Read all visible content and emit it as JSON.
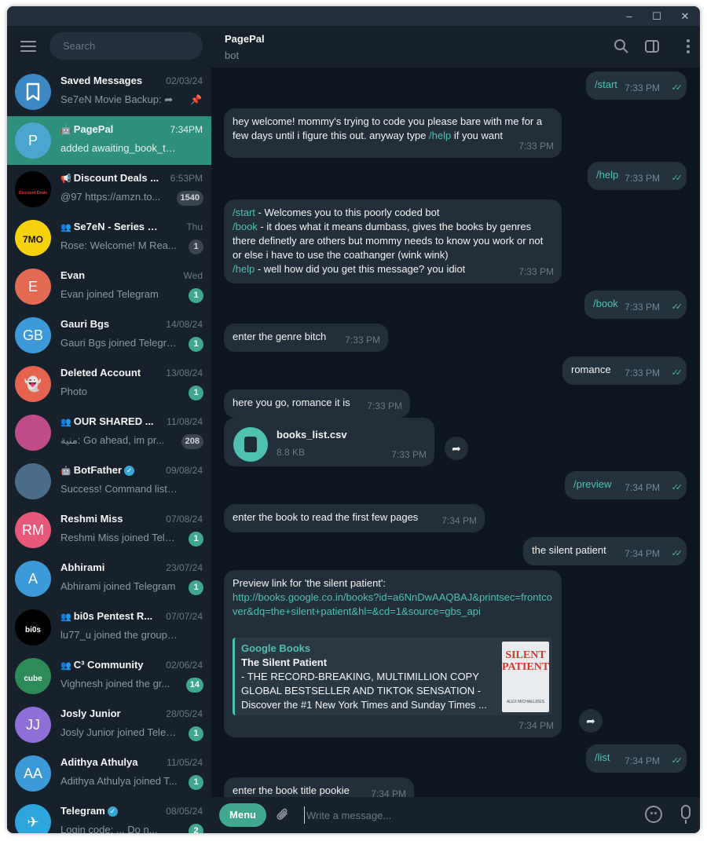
{
  "window": {
    "controls": [
      "–",
      "☐",
      "✕"
    ]
  },
  "sidebar": {
    "search_placeholder": "Search",
    "chats": [
      {
        "name": "Saved Messages",
        "date": "02/03/24",
        "preview": "Se7eN Movie Backup: ➦",
        "avatar_text": "",
        "avatar_color": "#3b88c4",
        "pinned": true
      },
      {
        "name": "PagePal",
        "date": "7:34PM",
        "preview": "added awaiting_book_two t...",
        "avatar_text": "P",
        "avatar_color": "#4aa6cf",
        "bot": true,
        "active": true
      },
      {
        "name": "Discount Deals ...",
        "date": "6:53PM",
        "preview": "@97 https://amzn.to...",
        "avatar_text": "Discount Deals Bay",
        "avatar_color": "#000000",
        "badge": "1540",
        "badge_muted": true,
        "channel": true
      },
      {
        "name": "Se7eN - Series Gro...",
        "date": "Thu",
        "preview": "Rose: Welcome! M  Rea...",
        "avatar_text": "7MO",
        "avatar_color": "#f5d20b",
        "badge": "1",
        "badge_muted": true,
        "group": true
      },
      {
        "name": "Evan",
        "date": "Wed",
        "preview": "Evan joined Telegram",
        "avatar_text": "E",
        "avatar_color": "#e36a53",
        "badge": "1"
      },
      {
        "name": "Gauri Bgs",
        "date": "14/08/24",
        "preview": "Gauri Bgs joined Telegra...",
        "avatar_text": "GB",
        "avatar_color": "#3d9ad8",
        "badge": "1"
      },
      {
        "name": "Deleted Account",
        "date": "13/08/24",
        "preview": "Photo",
        "avatar_text": "👻",
        "avatar_color": "#e6634f",
        "badge": "1"
      },
      {
        "name": "OUR SHARED ...",
        "date": "11/08/24",
        "preview": "منية: Go ahead, im pr...",
        "avatar_text": "",
        "avatar_color": "#c04b8a",
        "badge": "208",
        "badge_muted": true,
        "group": true
      },
      {
        "name": "BotFather",
        "date": "09/08/24",
        "preview": "Success! Command list upd...",
        "avatar_text": "",
        "avatar_color": "#4a6d8c",
        "bot": true,
        "verified": true
      },
      {
        "name": "Reshmi Miss",
        "date": "07/08/24",
        "preview": "Reshmi Miss joined Tele...",
        "avatar_text": "RM",
        "avatar_color": "#e8587a",
        "badge": "1"
      },
      {
        "name": "Abhirami",
        "date": "23/07/24",
        "preview": "Abhirami joined Telegram",
        "avatar_text": "A",
        "avatar_color": "#3d9ad8",
        "badge": "1"
      },
      {
        "name": "bi0s Pentest R...",
        "date": "07/07/24",
        "preview": "lu77_u joined the group via i...",
        "avatar_text": "bi0s",
        "avatar_color": "#000000",
        "group": true
      },
      {
        "name": "C³ Community",
        "date": "02/06/24",
        "preview": "Vighnesh joined the gr...",
        "avatar_text": "cube",
        "avatar_color": "#2e8b57",
        "badge": "14",
        "group": true
      },
      {
        "name": "Josly Junior",
        "date": "28/05/24",
        "preview": "Josly Junior joined Teleg...",
        "avatar_text": "JJ",
        "avatar_color": "#8e6fd8",
        "badge": "1"
      },
      {
        "name": "Adithya Athulya",
        "date": "11/05/24",
        "preview": "Adithya Athulya joined T...",
        "avatar_text": "AA",
        "avatar_color": "#3d9ad8",
        "badge": "1"
      },
      {
        "name": "Telegram",
        "date": "08/05/24",
        "preview": "Login code: ... Do n...",
        "avatar_text": "✈",
        "avatar_color": "#2ea6dd",
        "badge": "2",
        "verified": true
      }
    ]
  },
  "header": {
    "name": "PagePal",
    "status": "bot"
  },
  "messages": [
    {
      "dir": "out",
      "text": "/start",
      "time": "7:33 PM"
    },
    {
      "dir": "in",
      "text": "hey welcome! mommy's trying to code you please bare with me for a few days until i figure this out. anyway type ",
      "cmd": "/help",
      "tail": " if you want",
      "time": "7:33 PM"
    },
    {
      "dir": "out",
      "text": "/help",
      "time": "7:33 PM"
    },
    {
      "dir": "in",
      "lines": [
        {
          "cmd": "/start",
          "text": " - Welcomes you to this poorly coded bot"
        },
        {
          "cmd": "/book",
          "text": " - it does what it means dumbass, gives the books by genres there definetly are others but mommy needs to know you work or not or else i have to use the coathanger (wink wink)"
        },
        {
          "cmd": "/help",
          "text": " - well how did you get this message? you idiot"
        }
      ],
      "time": "7:33 PM"
    },
    {
      "dir": "out",
      "text": "/book",
      "time": "7:33 PM"
    },
    {
      "dir": "in",
      "text": "enter the genre bitch",
      "time": "7:33 PM"
    },
    {
      "dir": "out",
      "text": "romance",
      "time": "7:33 PM"
    },
    {
      "dir": "in",
      "text": "here you go, romance it is",
      "time": "7:33 PM"
    },
    {
      "dir": "in",
      "file_name": "books_list.csv",
      "file_size": "8.8 KB",
      "time": "7:33 PM"
    },
    {
      "dir": "out",
      "text": "/preview",
      "time": "7:34 PM"
    },
    {
      "dir": "in",
      "text": "enter the book to read the first few pages",
      "time": "7:34 PM"
    },
    {
      "dir": "out",
      "text": "the silent patient",
      "time": "7:34 PM"
    },
    {
      "dir": "in",
      "text": "Preview link for 'the silent patient':",
      "link": "http://books.google.co.in/books?id=a6NnDwAAQBAJ&printsec=frontcover&dq=the+silent+patient&hl=&cd=1&source=gbs_api",
      "card": {
        "site": "Google Books",
        "title": "The Silent Patient",
        "desc": "- THE RECORD-BREAKING, MULTIMILLION COPY GLOBAL BESTSELLER AND TIKTOK SENSATION - Discover the #1 New York Times and Sunday Times ...",
        "thumb_title": "SILENT PATIENT",
        "thumb_author": "ALEX MICHAELIDES"
      },
      "time": "7:34 PM"
    },
    {
      "dir": "out",
      "text": "/list",
      "time": "7:34 PM"
    },
    {
      "dir": "in",
      "text": "enter the book title pookie",
      "time": "7:34 PM"
    }
  ],
  "composer": {
    "menu_label": "Menu",
    "placeholder": "Write a message..."
  },
  "colors": {
    "accent": "#3fa88f",
    "link": "#4ec1b0",
    "bg": "#0e1621",
    "panel": "#17212b"
  }
}
